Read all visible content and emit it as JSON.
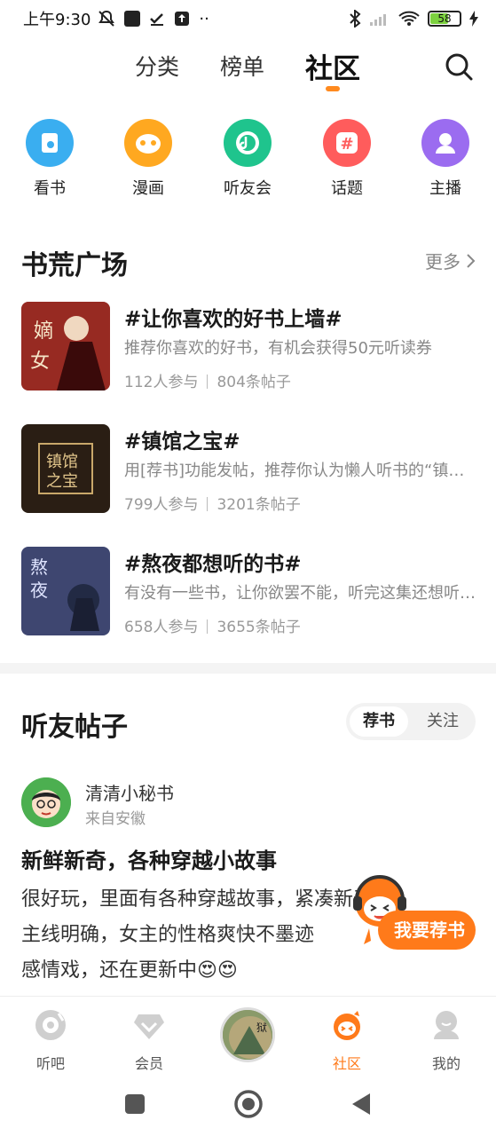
{
  "status_bar": {
    "time": "上午9:30",
    "battery_level": "58"
  },
  "top_tabs": [
    {
      "label": "分类",
      "active": false
    },
    {
      "label": "榜单",
      "active": false
    },
    {
      "label": "社区",
      "active": true
    }
  ],
  "quick_entries": [
    {
      "label": "看书",
      "icon": "book-icon",
      "color": "#3aaef0"
    },
    {
      "label": "漫画",
      "icon": "comic-icon",
      "color": "#ffa820"
    },
    {
      "label": "听友会",
      "icon": "listener-club-icon",
      "color": "#1fc48d"
    },
    {
      "label": "话题",
      "icon": "hashtag-icon",
      "color": "#ff5c5c"
    },
    {
      "label": "主播",
      "icon": "anchor-icon",
      "color": "#9b6cf0"
    }
  ],
  "book_plaza": {
    "title": "书荒广场",
    "more_label": "更多",
    "topics": [
      {
        "title": "#让你喜欢的好书上墙#",
        "desc": "推荐你喜欢的好书，有机会获得50元听读券",
        "participants": "112人参与",
        "posts": "804条帖子"
      },
      {
        "title": "#镇馆之宝#",
        "desc": "用[荐书]功能发帖，推荐你认为懒人听书的“镇馆之宝”",
        "participants": "799人参与",
        "posts": "3201条帖子"
      },
      {
        "title": "#熬夜都想听的书#",
        "desc": "有没有一些书，让你欲罢不能，听完这集还想听下一集",
        "participants": "658人参与",
        "posts": "3655条帖子"
      }
    ]
  },
  "posts_section": {
    "title": "听友帖子",
    "segments": [
      {
        "label": "荐书",
        "active": true
      },
      {
        "label": "关注",
        "active": false
      }
    ]
  },
  "post": {
    "username": "清清小秘书",
    "location": "来自安徽",
    "title": "新鲜新奇，各种穿越小故事",
    "body_lines": [
      "很好玩，里面有各种穿越故事，紧凑新奇，",
      "主线明确，女主的性格爽快不墨迹",
      "感情戏，还在更新中😍😍"
    ]
  },
  "float_button": {
    "label": "我要荐书"
  },
  "bottom_nav": [
    {
      "label": "听吧",
      "icon": "disc-icon",
      "active": false
    },
    {
      "label": "会员",
      "icon": "diamond-icon",
      "active": false
    },
    {
      "label": "社区",
      "icon": "community-icon",
      "active": true
    },
    {
      "label": "我的",
      "icon": "profile-icon",
      "active": false
    }
  ],
  "colors": {
    "accent": "#ff7a1a"
  }
}
